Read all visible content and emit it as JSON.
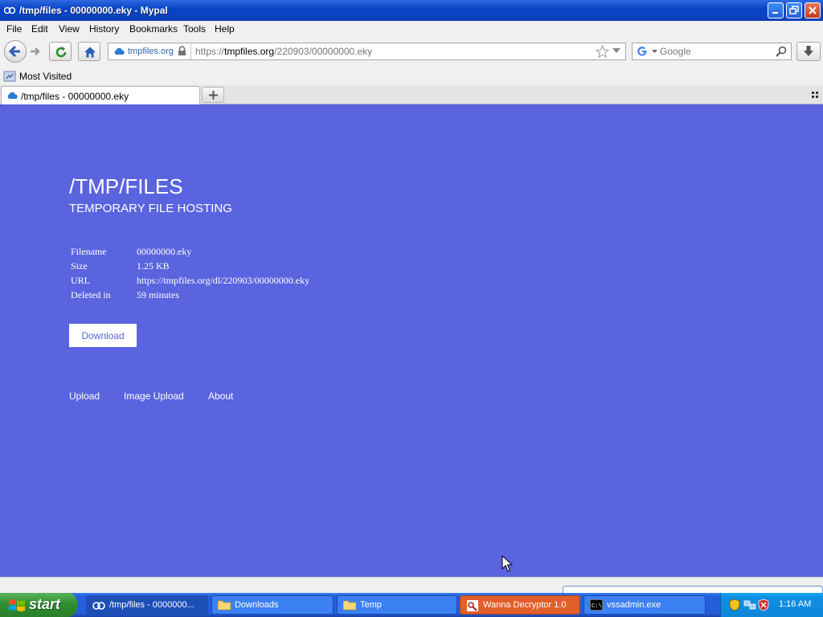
{
  "window": {
    "title": "/tmp/files - 00000000.eky - Mypal"
  },
  "menubar": [
    "File",
    "Edit",
    "View",
    "History",
    "Bookmarks",
    "Tools",
    "Help"
  ],
  "navbar": {
    "identity_host": "tmpfiles.org",
    "url_prefix": "https://",
    "url_domain": "tmpfiles.org",
    "url_path": "/220903/00000000.eky",
    "search_placeholder": "Google"
  },
  "bookmarks": {
    "most_visited": "Most Visited"
  },
  "tabs": [
    {
      "label": "/tmp/files - 00000000.eky"
    }
  ],
  "page": {
    "title": "/TMP/FILES",
    "subtitle": "TEMPORARY FILE HOSTING",
    "info": [
      {
        "key": "Filename",
        "value": "00000000.eky"
      },
      {
        "key": "Size",
        "value": "1.25 KB"
      },
      {
        "key": "URL",
        "value": "https://tmpfiles.org/dl/220903/00000000.eky"
      },
      {
        "key": "Deleted in",
        "value": "59 minutes"
      }
    ],
    "download_label": "Download",
    "footer_links": [
      "Upload",
      "Image Upload",
      "About"
    ],
    "background_color": "#5a64de"
  },
  "taskbar": {
    "start_label": "start",
    "tasks": [
      {
        "label": "/tmp/files - 0000000...",
        "icon": "browser-icon"
      },
      {
        "label": "Downloads",
        "icon": "folder-icon"
      },
      {
        "label": "Temp",
        "icon": "folder-icon"
      },
      {
        "label": "Wanna Decryptor 1.0",
        "icon": "wanna-decryptor-icon"
      },
      {
        "label": "vssadmin.exe",
        "icon": "console-icon"
      }
    ],
    "clock": "1:16 AM"
  }
}
